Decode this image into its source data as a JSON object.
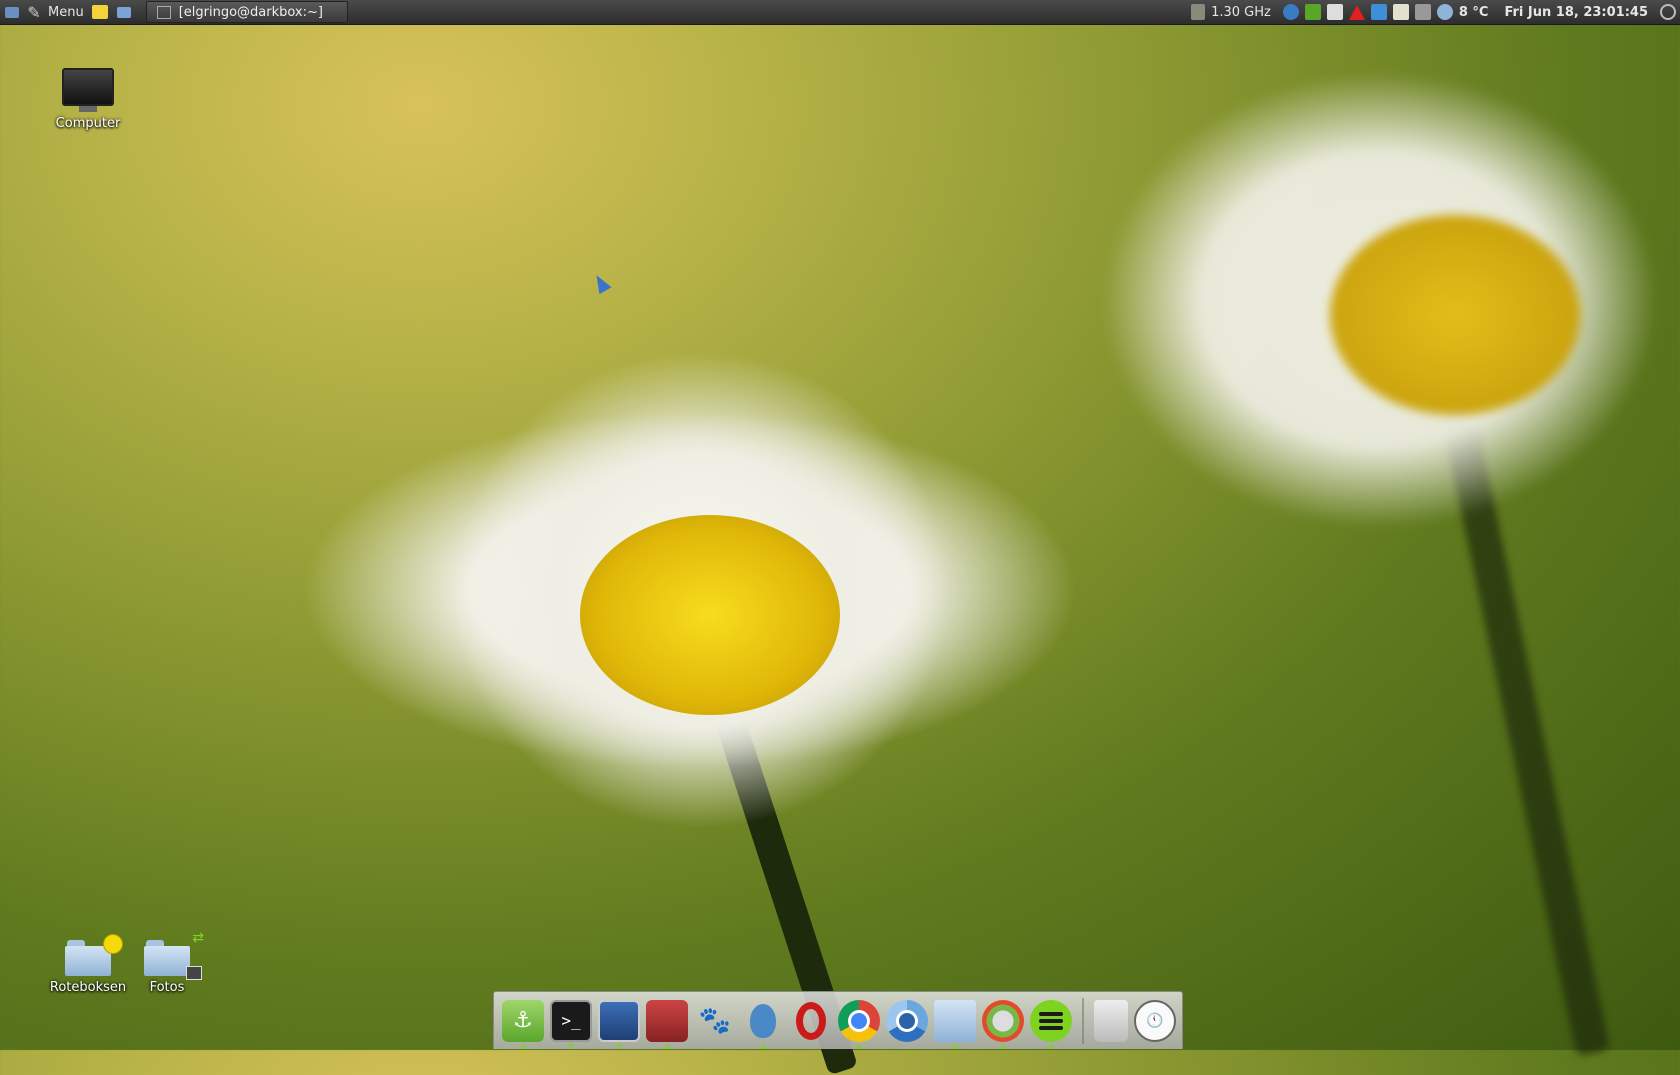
{
  "top_panel": {
    "menu_label": "Menu",
    "task_title": "[elgringo@darkbox:~]",
    "cpu_freq": "1.30 GHz",
    "temperature": "8 °C",
    "datetime": "Fri Jun 18, 23:01:45"
  },
  "desktop": {
    "icons": [
      {
        "label": "Computer"
      },
      {
        "label": "Roteboksen"
      },
      {
        "label": "Fotos"
      }
    ]
  },
  "dock": {
    "items": [
      "anchor-icon",
      "terminal-icon",
      "floppy-save-icon",
      "photo-viewer-icon",
      "gimp-icon",
      "pidgin-icon",
      "opera-icon",
      "chrome-icon",
      "chromium-icon",
      "file-manager-icon",
      "alert-app-icon",
      "spotify-icon",
      "trash-icon",
      "clock-icon"
    ]
  },
  "colors": {
    "panel_bg": "#2d2d2d",
    "accent_blue": "#3a74c8",
    "spotify_green": "#7ed321",
    "opera_red": "#cc1a1a"
  }
}
